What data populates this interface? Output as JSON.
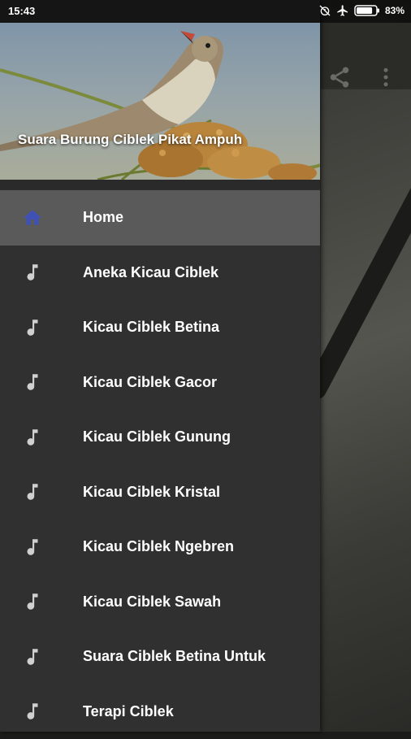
{
  "status_bar": {
    "time": "15:43",
    "battery_percent": "83%",
    "battery_level": 0.83,
    "icons": [
      "alarm-off-icon",
      "airplane-mode-icon",
      "battery-icon"
    ]
  },
  "drawer": {
    "header_title": "Suara Burung Ciblek Pikat Ampuh",
    "items": [
      {
        "label": "Home",
        "icon": "home-icon",
        "selected": true
      },
      {
        "label": "Aneka Kicau Ciblek",
        "icon": "music-note-icon"
      },
      {
        "label": "Kicau Ciblek Betina",
        "icon": "music-note-icon"
      },
      {
        "label": "Kicau Ciblek Gacor",
        "icon": "music-note-icon"
      },
      {
        "label": "Kicau Ciblek Gunung",
        "icon": "music-note-icon"
      },
      {
        "label": "Kicau Ciblek Kristal",
        "icon": "music-note-icon"
      },
      {
        "label": "Kicau Ciblek Ngebren",
        "icon": "music-note-icon"
      },
      {
        "label": "Kicau Ciblek Sawah",
        "icon": "music-note-icon"
      },
      {
        "label": "Suara Ciblek Betina Untuk",
        "icon": "music-note-icon"
      },
      {
        "label": "Terapi Ciblek",
        "icon": "music-note-icon"
      }
    ]
  },
  "toolbar": {
    "icons": [
      "share-icon",
      "more-vert-icon"
    ]
  },
  "colors": {
    "drawer_bg": "#303030",
    "selected_bg": "#5a5a5a",
    "home_icon": "#3f51b5",
    "note_icon": "#d0d0d0"
  }
}
